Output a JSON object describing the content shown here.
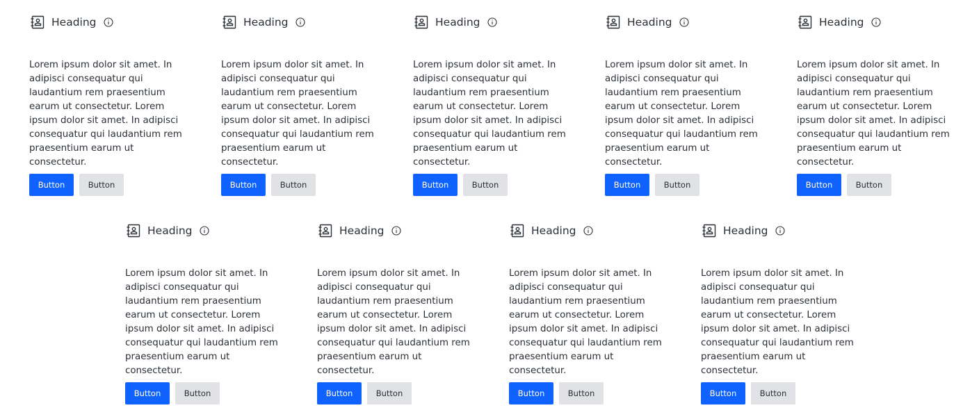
{
  "cards": [
    {
      "heading": "Heading",
      "body": "Lorem ipsum dolor sit amet. In adipisci consequatur qui laudantium rem praesentium earum ut consectetur. Lorem ipsum dolor sit amet. In adipisci consequatur qui laudantium rem praesentium earum ut consectetur.",
      "primary_label": "Button",
      "secondary_label": "Button"
    },
    {
      "heading": "Heading",
      "body": "Lorem ipsum dolor sit amet. In adipisci consequatur qui laudantium rem praesentium earum ut consectetur. Lorem ipsum dolor sit amet. In adipisci consequatur qui laudantium rem praesentium earum ut consectetur.",
      "primary_label": "Button",
      "secondary_label": "Button"
    },
    {
      "heading": "Heading",
      "body": "Lorem ipsum dolor sit amet. In adipisci consequatur qui laudantium rem praesentium earum ut consectetur. Lorem ipsum dolor sit amet. In adipisci consequatur qui laudantium rem praesentium earum ut consectetur.",
      "primary_label": "Button",
      "secondary_label": "Button"
    },
    {
      "heading": "Heading",
      "body": "Lorem ipsum dolor sit amet. In adipisci consequatur qui laudantium rem praesentium earum ut consectetur. Lorem ipsum dolor sit amet. In adipisci consequatur qui laudantium rem praesentium earum ut consectetur.",
      "primary_label": "Button",
      "secondary_label": "Button"
    },
    {
      "heading": "Heading",
      "body": "Lorem ipsum dolor sit amet. In adipisci consequatur qui laudantium rem praesentium earum ut consectetur. Lorem ipsum dolor sit amet. In adipisci consequatur qui laudantium rem praesentium earum ut consectetur.",
      "primary_label": "Button",
      "secondary_label": "Button"
    },
    {
      "heading": "Heading",
      "body": "Lorem ipsum dolor sit amet. In adipisci consequatur qui laudantium rem praesentium earum ut consectetur. Lorem ipsum dolor sit amet. In adipisci consequatur qui laudantium rem praesentium earum ut consectetur.",
      "primary_label": "Button",
      "secondary_label": "Button"
    },
    {
      "heading": "Heading",
      "body": "Lorem ipsum dolor sit amet. In adipisci consequatur qui laudantium rem praesentium earum ut consectetur. Lorem ipsum dolor sit amet. In adipisci consequatur qui laudantium rem praesentium earum ut consectetur.",
      "primary_label": "Button",
      "secondary_label": "Button"
    },
    {
      "heading": "Heading",
      "body": "Lorem ipsum dolor sit amet. In adipisci consequatur qui laudantium rem praesentium earum ut consectetur. Lorem ipsum dolor sit amet. In adipisci consequatur qui laudantium rem praesentium earum ut consectetur.",
      "primary_label": "Button",
      "secondary_label": "Button"
    },
    {
      "heading": "Heading",
      "body": "Lorem ipsum dolor sit amet. In adipisci consequatur qui laudantium rem praesentium earum ut consectetur. Lorem ipsum dolor sit amet. In adipisci consequatur qui laudantium rem praesentium earum ut consectetur.",
      "primary_label": "Button",
      "secondary_label": "Button"
    }
  ],
  "colors": {
    "primary": "#0f62fe",
    "secondary": "#e0e2e5",
    "text": "#2a2f36"
  },
  "icons": {
    "heading_icon": "address-book-icon",
    "info_icon": "info-icon"
  }
}
